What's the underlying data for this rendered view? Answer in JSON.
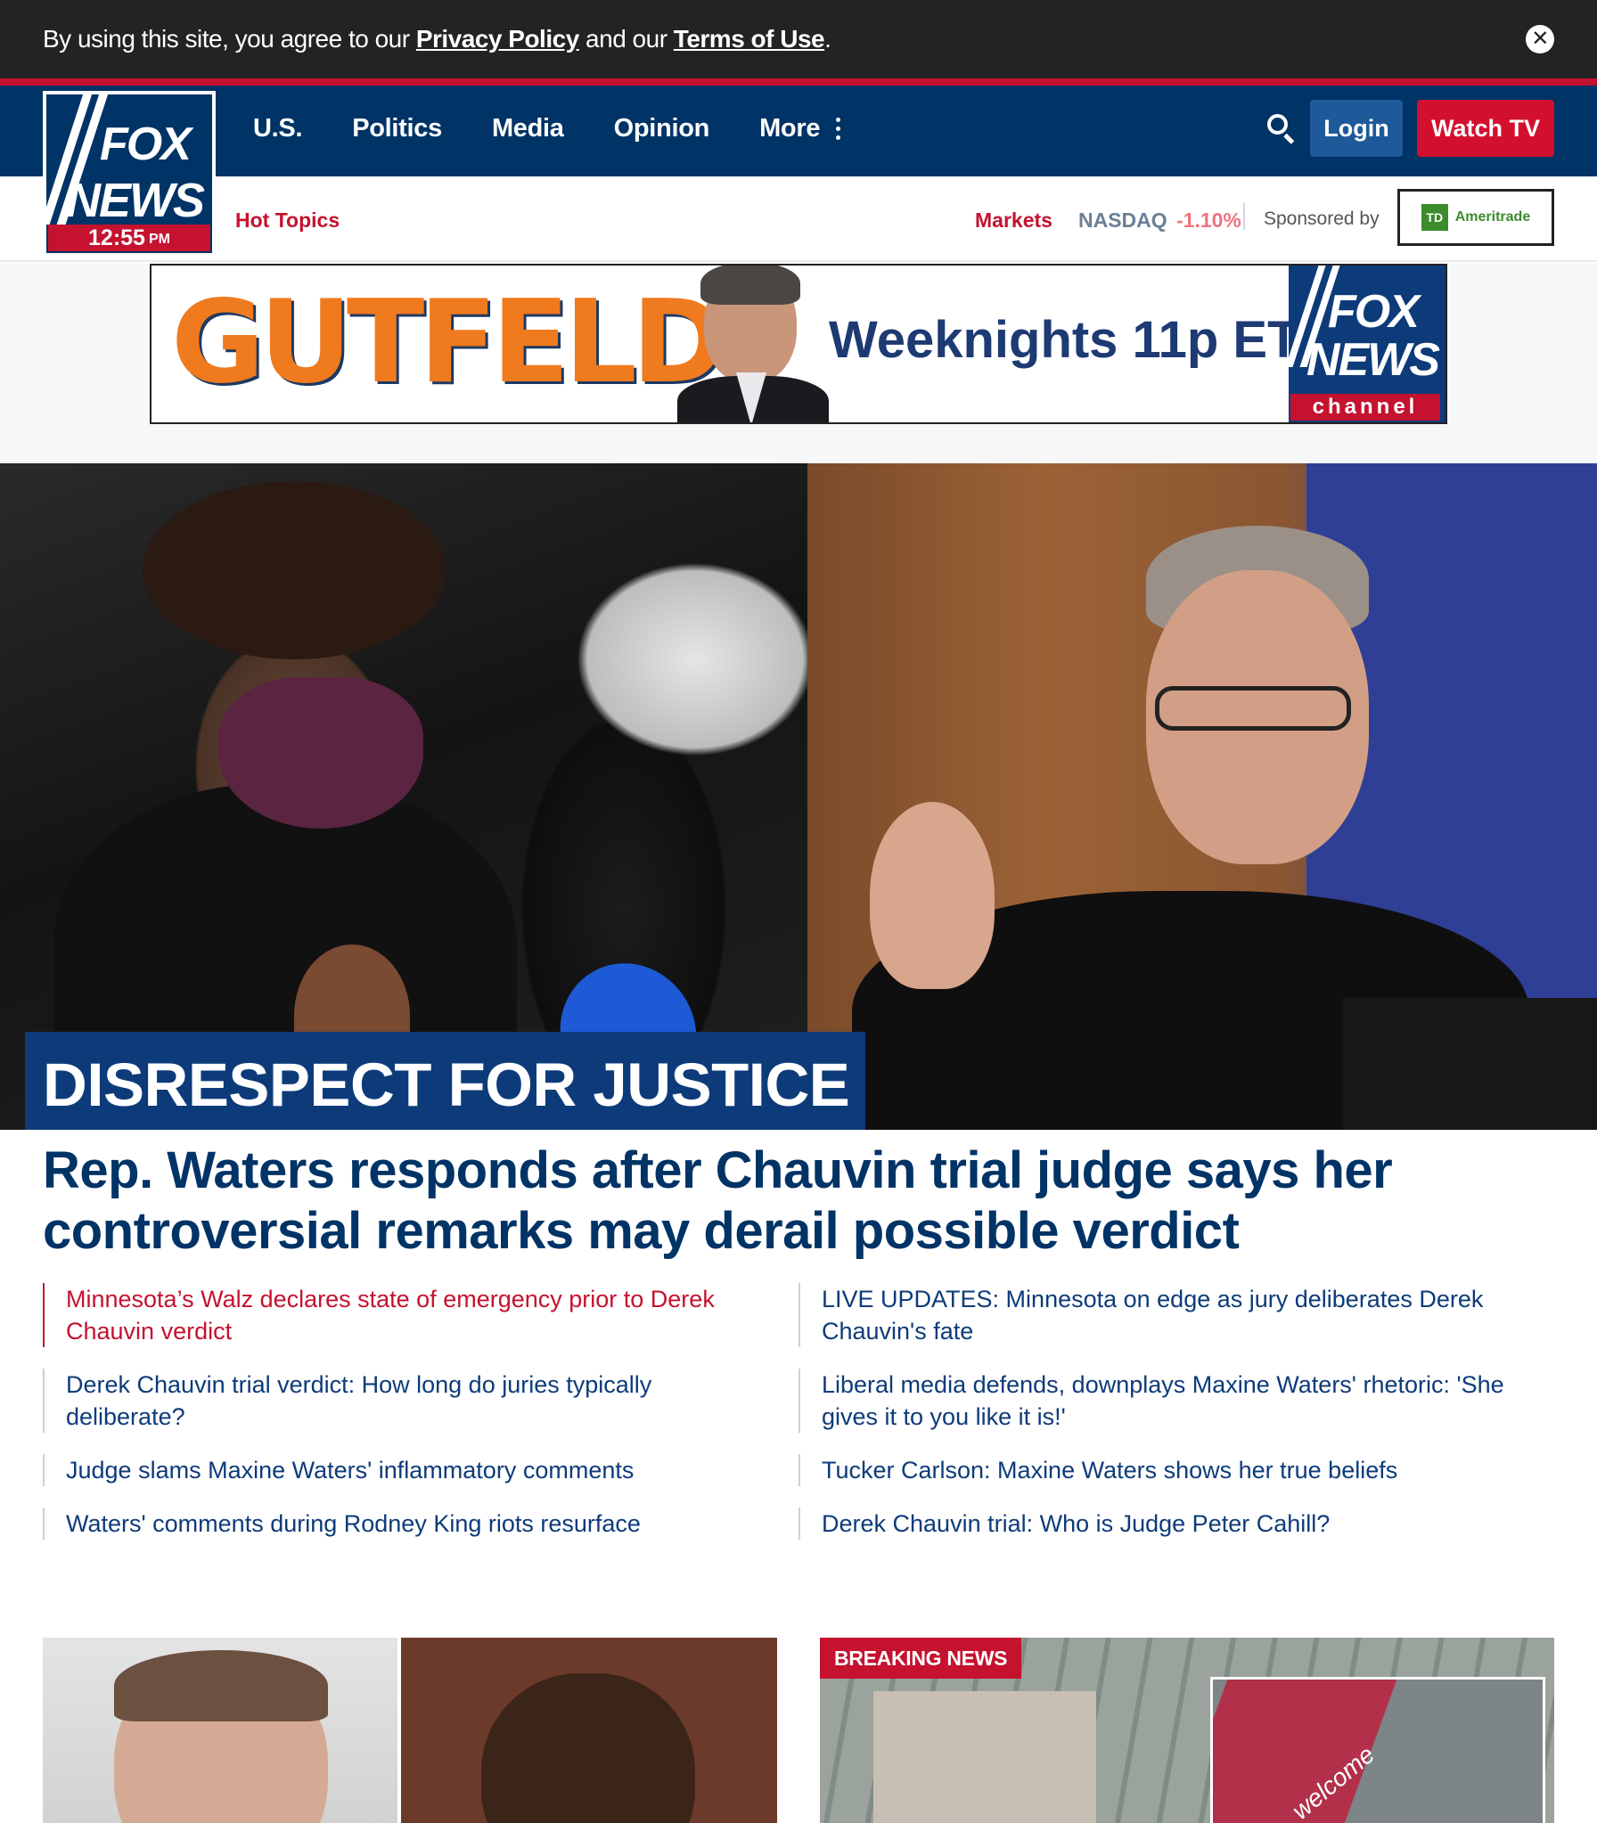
{
  "cookie_bar": {
    "prefix": "By using this site, you agree to our",
    "privacy_link": "Privacy Policy",
    "middle": "and our",
    "terms_link": "Terms of Use",
    "suffix": ".",
    "close_icon": "close-icon"
  },
  "logo": {
    "line1": "FOX",
    "line2": "NEWS",
    "time": "12:55",
    "ampm": "PM"
  },
  "nav": {
    "items": [
      "U.S.",
      "Politics",
      "Media",
      "Opinion",
      "More"
    ],
    "search_icon": "search-icon",
    "login": "Login",
    "watch_tv": "Watch TV"
  },
  "subbar": {
    "hot_topics": "Hot Topics",
    "markets": "Markets",
    "nasdaq_label": "NASDAQ",
    "nasdaq_change": "-1.10%",
    "sponsored_by": "Sponsored by",
    "sponsor_logo_td": "TD",
    "sponsor_name": "Ameritrade"
  },
  "ad": {
    "show": "GUTFELD!",
    "schedule": "Weeknights 11p ET",
    "network_line1": "FOX",
    "network_line2": "NEWS",
    "network_line3": "channel"
  },
  "hero": {
    "label": "DISRESPECT FOR JUSTICE",
    "headline": "Rep. Waters responds after Chauvin trial judge says her controversial remarks may derail possible verdict"
  },
  "related": {
    "col1": [
      "Minnesota’s Walz declares state of emergency prior to Derek Chauvin verdict",
      "Derek Chauvin trial verdict: How long do juries typically deliberate?",
      "Judge slams Maxine Waters' inflammatory comments",
      "Waters' comments during Rodney King riots resurface"
    ],
    "col2": [
      "LIVE UPDATES: Minnesota on edge as jury deliberates Derek Chauvin's fate",
      "Liberal media defends, downplays Maxine Waters' rhetoric: 'She gives it to you like it is!'",
      "Tucker Carlson: Maxine Waters shows her true beliefs",
      "Derek Chauvin trial: Who is Judge Peter Cahill?"
    ]
  },
  "cards": {
    "breaking_badge": "BREAKING NEWS",
    "inset_sign": "welcome"
  },
  "colors": {
    "brand_navy": "#003366",
    "brand_red": "#c4122f",
    "login_blue": "#1e5a9a"
  }
}
